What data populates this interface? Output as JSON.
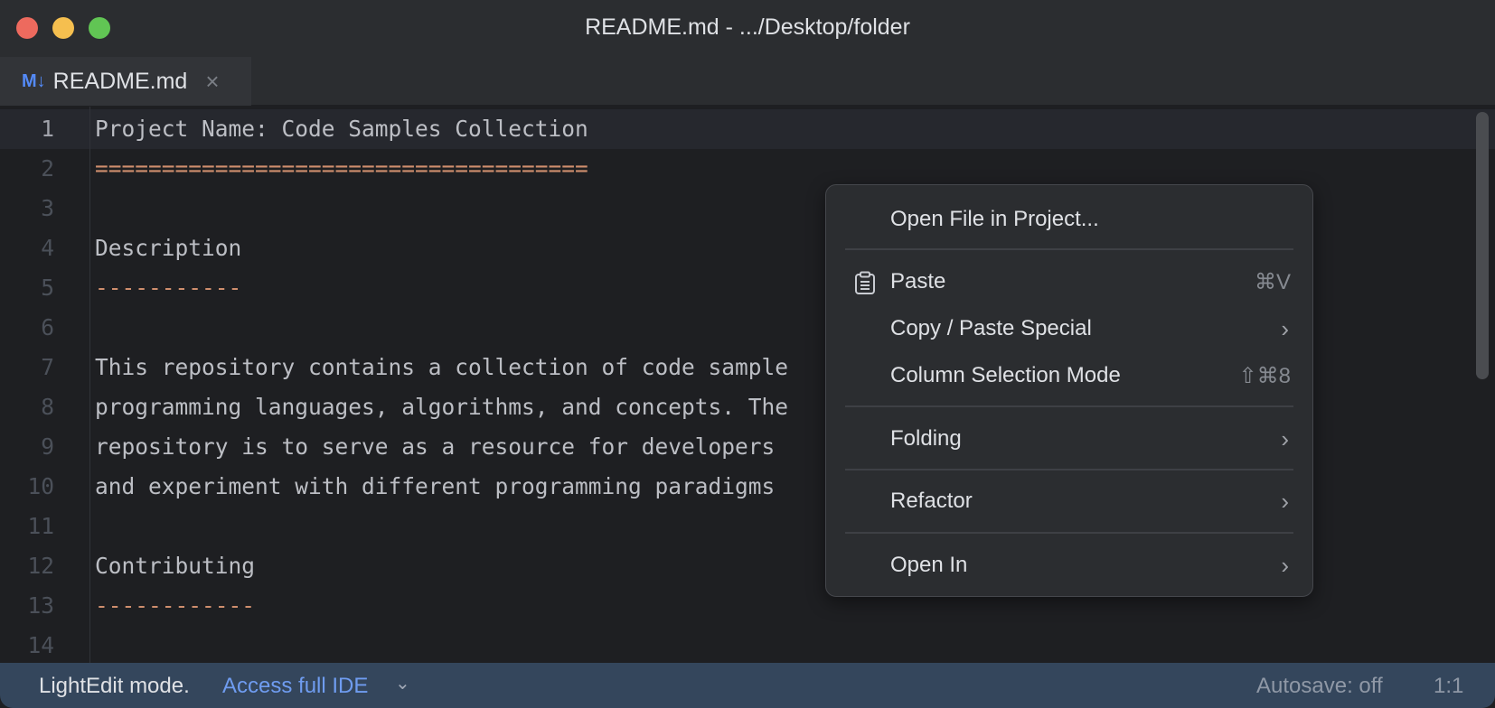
{
  "window": {
    "title": "README.md - .../Desktop/folder"
  },
  "tab": {
    "icon": "M↓",
    "label": "README.md",
    "close": "×"
  },
  "editor": {
    "lines": [
      {
        "n": "1",
        "text": "Project Name: Code Samples Collection",
        "style": "plain"
      },
      {
        "n": "2",
        "text": "=====================================",
        "style": "orange"
      },
      {
        "n": "3",
        "text": "",
        "style": "plain"
      },
      {
        "n": "4",
        "text": "Description",
        "style": "plain"
      },
      {
        "n": "5",
        "text": "-----------",
        "style": "orange"
      },
      {
        "n": "6",
        "text": "",
        "style": "plain"
      },
      {
        "n": "7",
        "text": "This repository contains a collection of code sample",
        "style": "plain"
      },
      {
        "n": "8",
        "text": "programming languages, algorithms, and concepts. The",
        "style": "plain"
      },
      {
        "n": "9",
        "text": "repository is to serve as a resource for developers",
        "style": "plain"
      },
      {
        "n": "10",
        "text": "and experiment with different programming paradigms",
        "style": "plain"
      },
      {
        "n": "11",
        "text": "",
        "style": "plain"
      },
      {
        "n": "12",
        "text": "Contributing",
        "style": "plain"
      },
      {
        "n": "13",
        "text": "------------",
        "style": "orange"
      },
      {
        "n": "14",
        "text": "",
        "style": "plain"
      }
    ]
  },
  "context_menu": {
    "open_file": "Open File in Project...",
    "paste": "Paste",
    "paste_shortcut": "⌘V",
    "copy_paste_special": "Copy / Paste Special",
    "column_selection": "Column Selection Mode",
    "column_shortcut": "⇧⌘8",
    "folding": "Folding",
    "refactor": "Refactor",
    "open_in": "Open In",
    "submenu_arrow": "›"
  },
  "status_bar": {
    "mode": "LightEdit mode.",
    "link": "Access full IDE",
    "chevron": "⌄",
    "autosave": "Autosave: off",
    "position": "1:1"
  },
  "colors": {
    "close": "#ed6a5e",
    "minimize": "#f5bf4f",
    "zoom": "#61c554",
    "accent": "#548af7"
  }
}
